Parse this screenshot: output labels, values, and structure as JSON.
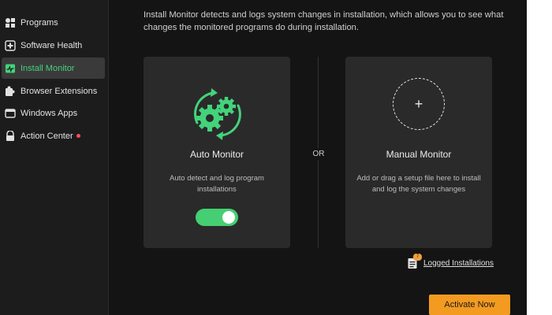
{
  "sidebar": {
    "items": [
      {
        "label": "Programs",
        "icon": "programs-icon",
        "active": false
      },
      {
        "label": "Software Health",
        "icon": "software-health-icon",
        "active": false
      },
      {
        "label": "Install Monitor",
        "icon": "install-monitor-icon",
        "active": true
      },
      {
        "label": "Browser Extensions",
        "icon": "browser-extensions-icon",
        "active": false
      },
      {
        "label": "Windows Apps",
        "icon": "windows-apps-icon",
        "active": false
      },
      {
        "label": "Action Center",
        "icon": "action-center-icon",
        "active": false,
        "has_notification": true
      }
    ]
  },
  "main": {
    "description": "Install Monitor detects and logs system changes in installation, which allows you to see what changes the monitored programs do during installation.",
    "auto_monitor": {
      "title": "Auto Monitor",
      "subtitle": "Auto detect and log program installations",
      "toggle_on": true
    },
    "separator": "OR",
    "manual_monitor": {
      "title": "Manual Monitor",
      "subtitle": "Add or drag a setup file here to install and log the system changes",
      "add_symbol": "+"
    },
    "logged_installations": {
      "label": "Logged Installations",
      "badge": "7"
    },
    "activate_button": "Activate Now"
  },
  "colors": {
    "accent_green": "#43d37b",
    "toggle_green": "#45cf72",
    "activate_orange": "#f39a21",
    "badge_orange": "#f0a13b",
    "notification_red": "#ff4d5e",
    "background": "#141414",
    "card": "#2a2a2a"
  }
}
